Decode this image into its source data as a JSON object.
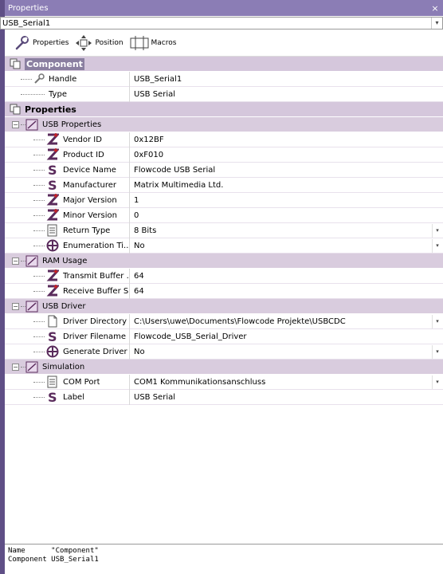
{
  "window": {
    "title": "Properties",
    "close": "×"
  },
  "selector": {
    "value": "USB_Serial1"
  },
  "tabs": [
    {
      "label": "Properties",
      "icon": "wrench-icon"
    },
    {
      "label": "Position",
      "icon": "move-arrows-icon"
    },
    {
      "label": "Macros",
      "icon": "macros-icon"
    }
  ],
  "categories": {
    "component": "Component",
    "properties": "Properties"
  },
  "component_rows": [
    {
      "name": "Handle",
      "value": "USB_Serial1"
    },
    {
      "name": "Type",
      "value": "USB Serial"
    }
  ],
  "groups": {
    "usb_properties": "USB Properties",
    "ram_usage": "RAM Usage",
    "usb_driver": "USB Driver",
    "simulation": "Simulation"
  },
  "usb_properties_rows": [
    {
      "name": "Vendor ID",
      "value": "0x12BF",
      "icon": "z-int-icon"
    },
    {
      "name": "Product ID",
      "value": "0xF010",
      "icon": "z-int-icon"
    },
    {
      "name": "Device Name",
      "value": "Flowcode USB Serial",
      "icon": "s-string-icon"
    },
    {
      "name": "Manufacturer",
      "value": "Matrix Multimedia Ltd.",
      "icon": "s-string-icon"
    },
    {
      "name": "Major Version",
      "value": "1",
      "icon": "z-int-icon"
    },
    {
      "name": "Minor Version",
      "value": "0",
      "icon": "z-int-icon"
    },
    {
      "name": "Return Type",
      "value": "8 Bits",
      "icon": "list-icon"
    },
    {
      "name": "Enumeration Ti...",
      "value": "No",
      "icon": "bool-icon"
    }
  ],
  "ram_rows": [
    {
      "name": "Transmit Buffer ...",
      "value": "64",
      "icon": "z-int-icon"
    },
    {
      "name": "Receive Buffer Size",
      "value": "64",
      "icon": "z-int-icon"
    }
  ],
  "driver_rows": [
    {
      "name": "Driver Directory",
      "value": "C:\\Users\\uwe\\Documents\\Flowcode Projekte\\USBCDC",
      "icon": "file-icon"
    },
    {
      "name": "Driver Filename",
      "value": "Flowcode_USB_Serial_Driver",
      "icon": "s-string-icon"
    },
    {
      "name": "Generate Driver",
      "value": "No",
      "icon": "bool-icon"
    }
  ],
  "sim_rows": [
    {
      "name": "COM Port",
      "value": "COM1 Kommunikationsanschluss",
      "icon": "list-icon"
    },
    {
      "name": "Label",
      "value": "USB Serial",
      "icon": "s-string-icon"
    }
  ],
  "description": {
    "line1": "Name      \"Component\"",
    "line2": "Component USB_Serial1"
  },
  "colors": {
    "title_bar": "#8b7db5",
    "category_bg": "#d5c7dc",
    "int_icon": "#5a2b5c",
    "string_icon": "#5a2b5c"
  }
}
